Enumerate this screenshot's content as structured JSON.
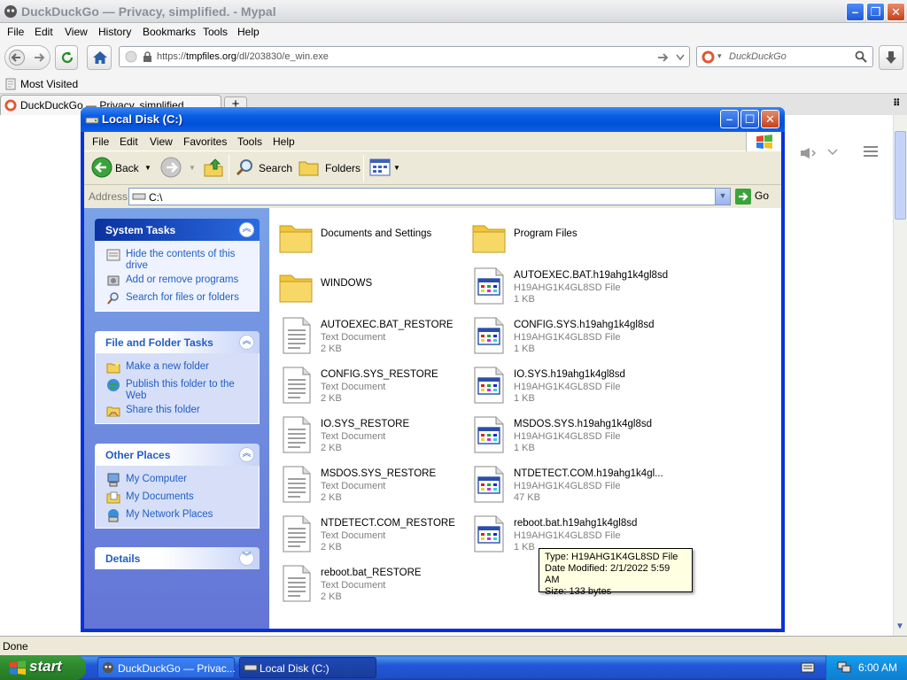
{
  "browser": {
    "title": "DuckDuckGo — Privacy, simplified. - Mypal",
    "menu": [
      "File",
      "Edit",
      "View",
      "History",
      "Bookmarks",
      "Tools",
      "Help"
    ],
    "url_prefix": "https://",
    "url_host": "tmpfiles.org",
    "url_path": "/dl/203830/e_win.exe",
    "search_placeholder": "DuckDuckGo",
    "bookmark": "Most Visited",
    "tab_label": "DuckDuckGo — Privacy, simplified",
    "status": "Done"
  },
  "explorer": {
    "title": "Local Disk (C:)",
    "menu": [
      "File",
      "Edit",
      "View",
      "Favorites",
      "Tools",
      "Help"
    ],
    "toolbar": {
      "back": "Back",
      "search": "Search",
      "folders": "Folders"
    },
    "address_label": "Address",
    "address_value": "C:\\",
    "go": "Go",
    "panels": {
      "system": {
        "title": "System Tasks",
        "items": [
          "Hide the contents of this drive",
          "Add or remove programs",
          "Search for files or folders"
        ]
      },
      "file": {
        "title": "File and Folder Tasks",
        "items": [
          "Make a new folder",
          "Publish this folder to the Web",
          "Share this folder"
        ]
      },
      "other": {
        "title": "Other Places",
        "items": [
          "My Computer",
          "My Documents",
          "My Network Places"
        ]
      },
      "details": {
        "title": "Details"
      }
    },
    "files": [
      {
        "name": "Documents and Settings",
        "kind": "folder"
      },
      {
        "name": "Program Files",
        "kind": "folder"
      },
      {
        "name": "WINDOWS",
        "kind": "folder"
      },
      {
        "name": "AUTOEXEC.BAT.h19ahg1k4gl8sd",
        "type": "H19AHG1K4GL8SD File",
        "size": "1 KB",
        "kind": "app"
      },
      {
        "name": "AUTOEXEC.BAT_RESTORE",
        "type": "Text Document",
        "size": "2 KB",
        "kind": "text"
      },
      {
        "name": "CONFIG.SYS.h19ahg1k4gl8sd",
        "type": "H19AHG1K4GL8SD File",
        "size": "1 KB",
        "kind": "app"
      },
      {
        "name": "CONFIG.SYS_RESTORE",
        "type": "Text Document",
        "size": "2 KB",
        "kind": "text"
      },
      {
        "name": "IO.SYS.h19ahg1k4gl8sd",
        "type": "H19AHG1K4GL8SD File",
        "size": "1 KB",
        "kind": "app"
      },
      {
        "name": "IO.SYS_RESTORE",
        "type": "Text Document",
        "size": "2 KB",
        "kind": "text"
      },
      {
        "name": "MSDOS.SYS.h19ahg1k4gl8sd",
        "type": "H19AHG1K4GL8SD File",
        "size": "1 KB",
        "kind": "app"
      },
      {
        "name": "MSDOS.SYS_RESTORE",
        "type": "Text Document",
        "size": "2 KB",
        "kind": "text"
      },
      {
        "name": "NTDETECT.COM.h19ahg1k4gl...",
        "type": "H19AHG1K4GL8SD File",
        "size": "47 KB",
        "kind": "app"
      },
      {
        "name": "NTDETECT.COM_RESTORE",
        "type": "Text Document",
        "size": "2 KB",
        "kind": "text"
      },
      {
        "name": "reboot.bat.h19ahg1k4gl8sd",
        "type": "H19AHG1K4GL8SD File",
        "size": "1 KB",
        "kind": "app"
      },
      {
        "name": "reboot.bat_RESTORE",
        "type": "Text Document",
        "size": "2 KB",
        "kind": "text"
      }
    ],
    "tooltip": [
      "Type: H19AHG1K4GL8SD File",
      "Date Modified: 2/1/2022 5:59 AM",
      "Size: 133 bytes"
    ]
  },
  "taskbar": {
    "start": "start",
    "tasks": [
      "DuckDuckGo — Privac...",
      "Local Disk (C:)"
    ],
    "clock": "6:00 AM"
  }
}
